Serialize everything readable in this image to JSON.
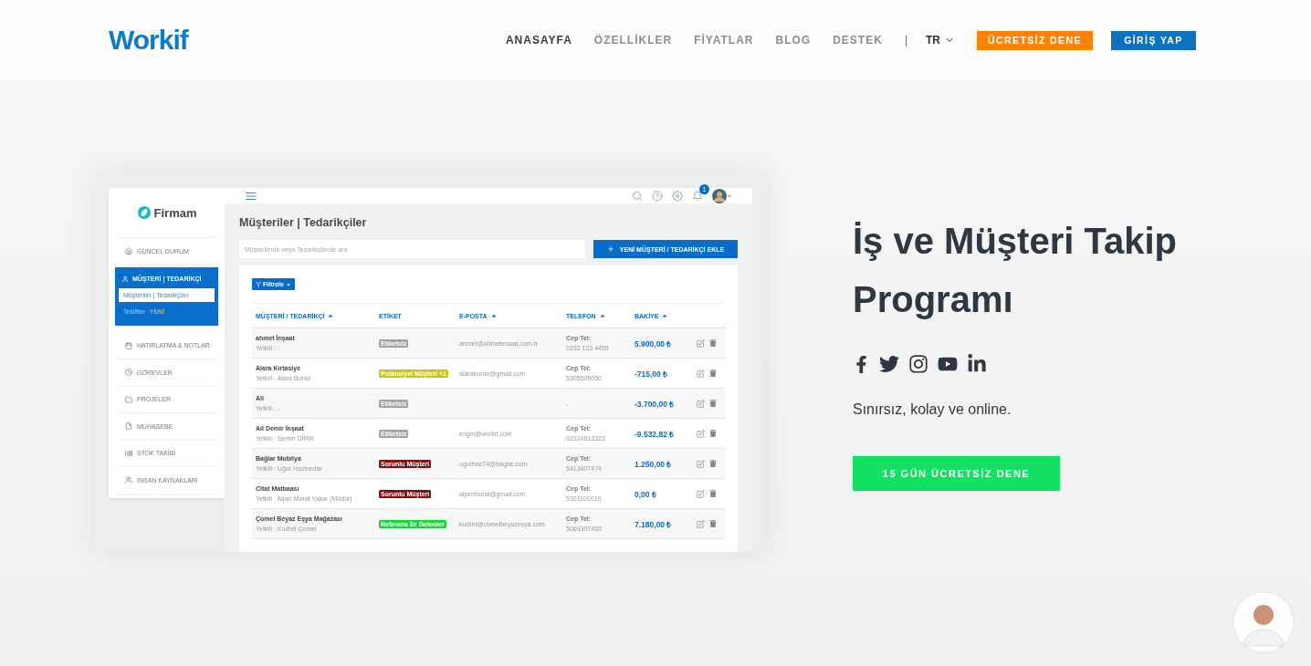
{
  "header": {
    "logo": "Workif",
    "nav": [
      {
        "label": "ANASAYFA",
        "selected": true
      },
      {
        "label": "ÖZELLİKLER",
        "selected": false
      },
      {
        "label": "FİYATLAR",
        "selected": false
      },
      {
        "label": "BLOG",
        "selected": false
      },
      {
        "label": "DESTEK",
        "selected": false
      }
    ],
    "separator": "|",
    "language": "TR",
    "trial_button": "ÜCRETSİZ DENE",
    "login_button": "GİRİŞ YAP"
  },
  "app": {
    "logo": "Firmam",
    "notification_count": "1",
    "sidebar": [
      {
        "label": "GÜNCEL DURUM",
        "expanded": false
      },
      {
        "label": "MÜŞTERİ | TEDARİKÇİ",
        "expanded": true,
        "children": [
          {
            "label": "Müşteriler | Tedarikçiler",
            "selected": true
          },
          {
            "label": "Teklifler",
            "badge": "YENİ",
            "selected": false
          }
        ]
      },
      {
        "label": "HATIRLATMA & NOTLAR",
        "expanded": false
      },
      {
        "label": "GÖREVLER",
        "expanded": false
      },
      {
        "label": "PROJELER",
        "expanded": false
      },
      {
        "label": "MUHASEBE",
        "expanded": false
      },
      {
        "label": "STOK TAKİBİ",
        "expanded": false
      },
      {
        "label": "İNSAN KAYNAKLARI",
        "expanded": false
      }
    ],
    "page_title": "Müşteriler | Tedarikçiler",
    "search": {
      "placeholder": "Müşterilerde veya Tedarikçilerde ara"
    },
    "add_button": "YENİ MÜŞTERİ / TEDARİKÇİ EKLE",
    "filter_button": "Filtrele",
    "table": {
      "columns": [
        {
          "label": "MÜŞTERİ / TEDARİKÇİ",
          "sortable": true
        },
        {
          "label": "ETİKET",
          "sortable": false
        },
        {
          "label": "E-POSTA",
          "sortable": true
        },
        {
          "label": "TELEFON",
          "sortable": true
        },
        {
          "label": "BAKİYE",
          "sortable": true
        }
      ],
      "rows": [
        {
          "name": "ahmet İnşaat",
          "contact": "Yetkili : -",
          "tag": "Etiketsiz",
          "color": "#a3a3a3",
          "email": "ahmet@ahmetinsaat.com.tr",
          "phone_label": "Cep Tel:",
          "phone": "0232 123 4455",
          "balance": "5.900,00 ₺"
        },
        {
          "name": "Alara Kırtasiye",
          "contact": "Yetkili : Alara Boran",
          "tag": "Potansiyel Müşteri +1",
          "color": "#c5c51a",
          "email": "alaraboran@gmail.com",
          "phone_label": "Cep Tel:",
          "phone": "5305505050",
          "balance": "-715,00 ₺"
        },
        {
          "name": "Ali",
          "contact": "Yetkili : -",
          "tag": "Etiketsiz",
          "color": "#a3a3a3",
          "phone": "-",
          "balance": "-3.700,00 ₺"
        },
        {
          "name": "Ali Demir İnşaat",
          "contact": "Yetkili : Semin DİRİK",
          "tag": "Etiketsiz",
          "color": "#a3a3a3",
          "email": "engin@workif.com",
          "phone_label": "Cep Tel:",
          "phone": "02324613322",
          "balance": "-9.532,82 ₺"
        },
        {
          "name": "Bağlar Mobilya",
          "contact": "Yetkili : Uğur Hazinedar",
          "tag": "Sorunlu Müşteri",
          "color": "#8a0b0b",
          "email": "ugurhaz74@baglar.com",
          "phone_label": "Cep Tel:",
          "phone": "5413407474",
          "balance": "1.250,00 ₺"
        },
        {
          "name": "Citat Matbaası",
          "contact": "Yetkili : Alper Murat Yakar (Müdür)",
          "tag": "Sorunlu Müşteri",
          "color": "#8a0b0b",
          "email": "alpermurat@gmail.com",
          "phone_label": "Cep Tel:",
          "phone": "5301101010",
          "balance": "0,00 ₺"
        },
        {
          "name": "Çomel Beyaz Eşya Mağazası",
          "contact": "Yetkili : Kudret Çomel",
          "tag": "Referans İle Gelenler",
          "color": "#19d43a",
          "email": "kudret@comelbeyazesya.com",
          "phone_label": "Cep Tel:",
          "phone": "5069397453",
          "balance": "7.180,00 ₺"
        }
      ]
    }
  },
  "hero": {
    "title": "İş ve Müşteri Takip Programı",
    "tagline": "Sınırsız, kolay ve online.",
    "cta_button": "15 GÜN ÜCRETSİZ DENE"
  }
}
